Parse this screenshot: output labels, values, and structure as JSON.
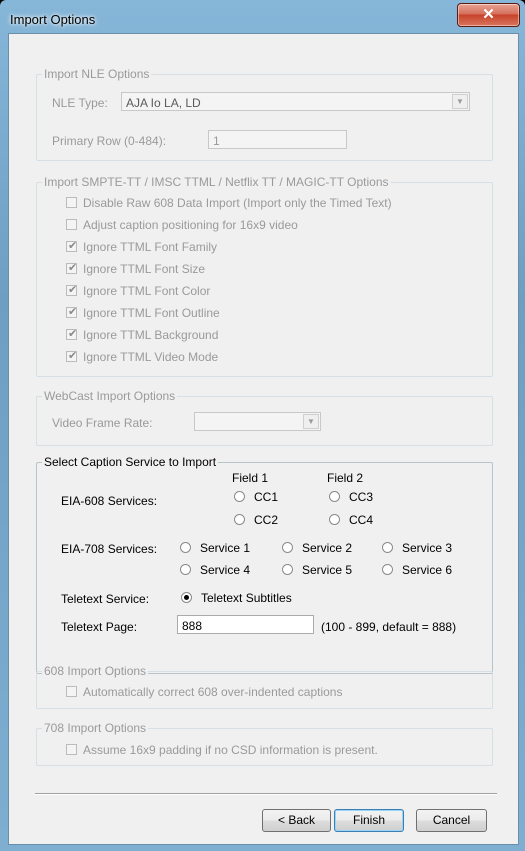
{
  "window": {
    "title": "Import Options"
  },
  "nle": {
    "caption": "Import NLE Options",
    "type_label": "NLE Type:",
    "type_value": "AJA Io LA, LD",
    "row_label": "Primary Row (0-484):",
    "row_value": "1"
  },
  "smpte": {
    "caption": "Import SMPTE-TT / IMSC TTML / Netflix TT / MAGIC-TT Options",
    "options": [
      {
        "label": "Disable Raw 608 Data Import (Import only the Timed Text)",
        "checked": false
      },
      {
        "label": "Adjust caption positioning for 16x9 video",
        "checked": false
      },
      {
        "label": "Ignore TTML Font Family",
        "checked": true
      },
      {
        "label": "Ignore TTML Font Size",
        "checked": true
      },
      {
        "label": "Ignore TTML Font Color",
        "checked": true
      },
      {
        "label": "Ignore TTML Font Outline",
        "checked": true
      },
      {
        "label": "Ignore TTML Background",
        "checked": true
      },
      {
        "label": "Ignore TTML Video Mode",
        "checked": true
      }
    ]
  },
  "webcast": {
    "caption": "WebCast Import Options",
    "frame_rate_label": "Video Frame Rate:",
    "frame_rate_value": ""
  },
  "service": {
    "caption": "Select Caption Service to Import",
    "field1": "Field 1",
    "field2": "Field 2",
    "eia608_label": "EIA-608 Services:",
    "cc": [
      "CC1",
      "CC3",
      "CC2",
      "CC4"
    ],
    "eia708_label": "EIA-708 Services:",
    "svc": [
      "Service 1",
      "Service 2",
      "Service 3",
      "Service 4",
      "Service 5",
      "Service 6"
    ],
    "teletext_label": "Teletext Service:",
    "teletext_option": "Teletext Subtitles",
    "page_label": "Teletext Page:",
    "page_value": "888",
    "page_hint": "(100 - 899, default = 888)"
  },
  "opt608": {
    "caption": "608 Import Options",
    "label": "Automatically correct 608 over-indented captions"
  },
  "opt708": {
    "caption": "708 Import Options",
    "label": "Assume 16x9 padding if no CSD information is present."
  },
  "buttons": {
    "back": "< Back",
    "finish": "Finish",
    "cancel": "Cancel"
  }
}
